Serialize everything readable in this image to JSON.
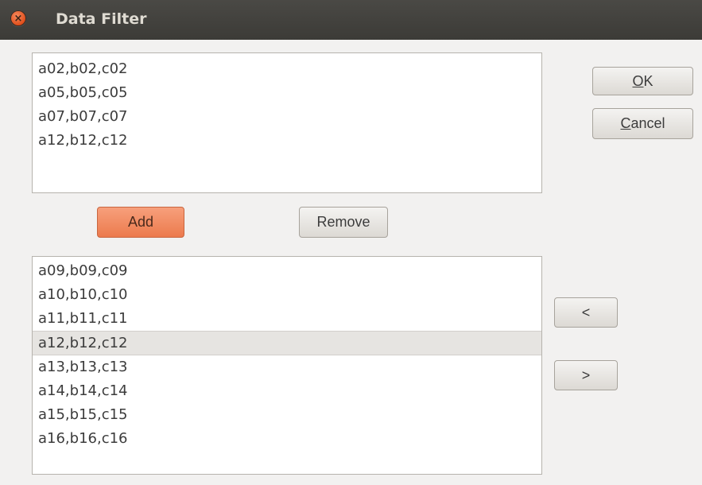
{
  "window": {
    "title": "Data Filter"
  },
  "top_list": {
    "items": [
      "a02,b02,c02",
      "a05,b05,c05",
      "a07,b07,c07",
      "a12,b12,c12"
    ]
  },
  "bottom_list": {
    "items": [
      "a09,b09,c09",
      "a10,b10,c10",
      "a11,b11,c11",
      "a12,b12,c12",
      "a13,b13,c13",
      "a14,b14,c14",
      "a15,b15,c15",
      "a16,b16,c16"
    ],
    "selected_index": 3
  },
  "buttons": {
    "ok": {
      "mnemonic": "O",
      "rest": "K"
    },
    "cancel": {
      "mnemonic": "C",
      "rest": "ancel"
    },
    "add": "Add",
    "remove": "Remove",
    "move_left": "<",
    "move_right": ">"
  },
  "colors": {
    "titlebar": "#3c3b37",
    "close_button": "#df4a16",
    "accent_button": "#ec7a4d",
    "selection": "#e6e4e1"
  },
  "icons": {
    "close": "close-icon"
  }
}
